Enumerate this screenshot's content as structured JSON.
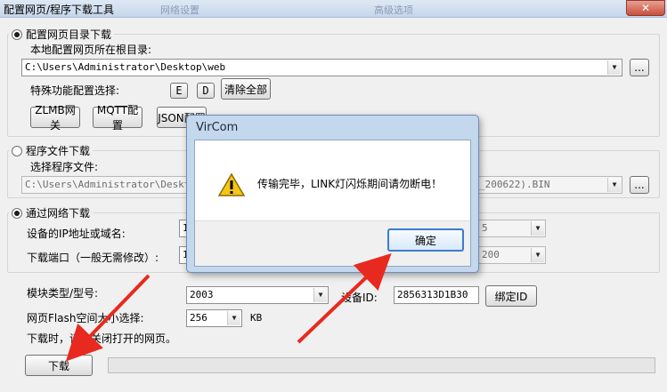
{
  "window": {
    "title": "配置网页/程序下载工具",
    "ghost_tab1": "网络设置",
    "ghost_tab2": "高级选项",
    "close_glyph": "✕"
  },
  "web_group": {
    "label": "配置网页目录下载",
    "root_label": "本地配置网页所在根目录:",
    "path_value": "C:\\Users\\Administrator\\Desktop\\web",
    "browse_label": "...",
    "special_label": "特殊功能配置选择:",
    "e_button": "E",
    "d_button": "D",
    "clear_all": "清除全部",
    "zlmb_button": "ZLMB网关",
    "mqtt_button": "MQTT配置",
    "json_button": "JSON配置"
  },
  "program_group": {
    "label": "程序文件下载",
    "select_label": "选择程序文件:",
    "path_left": "C:\\Users\\Administrator\\Desktop\\",
    "path_right": "_200622).BIN",
    "browse_label": "..."
  },
  "network_group": {
    "label": "通过网络下载",
    "ip_label": "设备的IP地址或域名:",
    "ip_value_left": "1",
    "ip_value_right": "5",
    "port_label": "下载端口（一般无需修改）:",
    "port_value_left": "1",
    "port_value_right": "200"
  },
  "module": {
    "type_label": "模块类型/型号:",
    "type_value": "2003",
    "device_id_label": "设备ID:",
    "device_id_value": "2856313D1B30",
    "bind_id_button": "绑定ID",
    "flash_label": "网页Flash空间大小选择:",
    "flash_value": "256",
    "flash_unit": "KB",
    "note": "下载时，请先关闭打开的网页。",
    "download_button": "下载"
  },
  "dialog": {
    "title": "VirCom",
    "message": "传输完毕，LINK灯闪烁期间请勿断电！",
    "ok_button": "确定"
  },
  "colors": {
    "arrow": "#e8291f",
    "accent": "#3b7bd1"
  }
}
